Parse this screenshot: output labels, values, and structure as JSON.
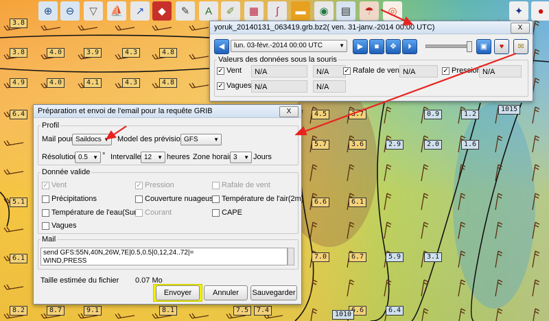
{
  "map": {
    "labels_row1": [
      "3.8",
      "4.0",
      "3.9",
      "4.3",
      "4.8"
    ],
    "labels_row2": [
      "4.9",
      "4.0",
      "4.1",
      "4.3",
      "4.8"
    ],
    "labels_right": [
      "4.5",
      "3.7",
      "0.9",
      "1.2"
    ],
    "labels_right2": [
      "5.7",
      "3.6",
      "2.9",
      "2.0",
      "1.6"
    ],
    "labels_mid": [
      "6.6",
      "6.1"
    ],
    "labels_low": [
      "7.0",
      "6.7",
      "5.9",
      "3.1"
    ],
    "labels_bottom": [
      "8.2",
      "8.7",
      "9.1",
      "8.1",
      "7.5",
      "7.4",
      "6.6",
      "6.4"
    ],
    "left_edge": [
      "3.8",
      "6.4",
      "5.1",
      "6.1"
    ],
    "isobar_1015": "1015",
    "isobar_1010": "1010"
  },
  "grib_window": {
    "title": "yoruk_20140131_063419.grb.bz2( ven. 31-janv.-2014 00:00  UTC)",
    "close": "X",
    "date_select": "lun. 03-févr.-2014 00:00  UTC",
    "section_title": "Valeurs des données sous la souris",
    "vent_label": "Vent",
    "vagues_label": "Vagues",
    "rafale_label": "Rafale de vent",
    "pression_label": "Pression",
    "na": "N/A"
  },
  "email_window": {
    "title": "Préparation et envoi de l'email pour la requête GRIB",
    "close": "X",
    "profil_title": "Profil",
    "mail_pour_label": "Mail pour",
    "mail_pour_value": "Saildocs",
    "model_label": "Model des prévisions",
    "model_value": "GFS",
    "resolution_label": "Résolution",
    "resolution_value": "0.5",
    "degree": "°",
    "intervalle_label": "Intervalle",
    "intervalle_value": "12",
    "heures": "heures",
    "zone_label": "Zone horaire",
    "zone_value": "3",
    "jours": "Jours",
    "donnee_title": "Donnée valide",
    "vent": "Vent",
    "pression": "Pression",
    "rafale": "Rafale de vent",
    "precipitations": "Précipitations",
    "couverture": "Couverture nuageuse",
    "temp_air": "Température de l'air(2m)",
    "temp_eau": "Température de l'eau(Surf.)",
    "courant": "Courant",
    "cape": "CAPE",
    "vagues": "Vagues",
    "mail_title": "Mail",
    "mail_line1": "send GFS:55N,40N,26W,7E|0.5,0.5|0,12,24..72|=",
    "mail_line2": "WIND,PRESS",
    "taille_label": "Taille estimée du fichier",
    "taille_value": "0.07 Mo",
    "envoyer": "Envoyer",
    "annuler": "Annuler",
    "sauvegarder": "Sauvegarder"
  },
  "colors": {
    "accent_red": "#e8231f",
    "highlight_yellow": "#f4f000"
  }
}
